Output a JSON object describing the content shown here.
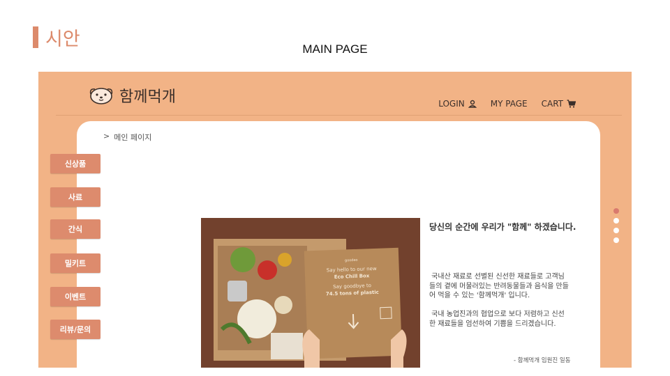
{
  "slide": {
    "title": "시안",
    "subtitle": "MAIN PAGE"
  },
  "site": {
    "logo_text": "함께먹개"
  },
  "nav": {
    "login": "LOGIN",
    "mypage": "MY PAGE",
    "cart": "CART"
  },
  "breadcrumb": {
    "arrow": ">",
    "label": "메인 페이지"
  },
  "sidebar": [
    "신상품",
    "사료",
    "간식",
    "밀키트",
    "이벤트",
    "리뷰/문의"
  ],
  "box_text": {
    "line1": "Say hello to our new",
    "line2": "Eco Chill Box",
    "line3": "Say goodbye to",
    "line4": "74.5 tons of plastic"
  },
  "main": {
    "headline": "당신의 순간에 우리가 \"함께\" 하겠습니다.",
    "para1": " 국내산 재료로 선별된 신선한 재료들로 고객님\n들의 곁에 머물러있는 반려동물들과 음식을 만들\n어 먹을 수 있는 '함께먹개' 입니다.",
    "para2": " 국내 농업진과의 협업으로 보다 저렴하고 신선\n한 재료들을 엄선하여 기쁨을 드리겠습니다.",
    "signature": "- 함께먹개 임원진 일동"
  },
  "carousel": {
    "total": 4,
    "active": 1
  },
  "colors": {
    "accent": "#dc8a6b",
    "header_bg": "#f2b386",
    "active_dot": "#d97a6e"
  }
}
